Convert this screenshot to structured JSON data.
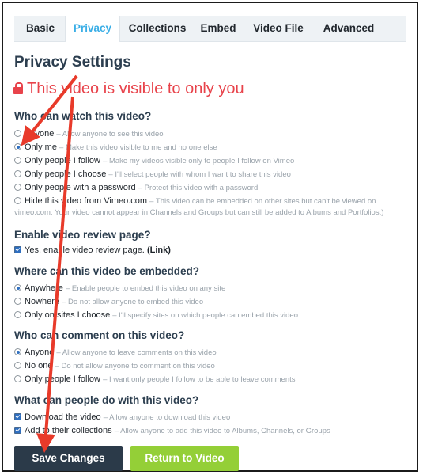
{
  "tabs": [
    {
      "label": "Basic",
      "active": false
    },
    {
      "label": "Privacy",
      "active": true
    },
    {
      "label": "Collections",
      "active": false
    },
    {
      "label": "Embed",
      "active": false
    },
    {
      "label": "Video File",
      "active": false
    },
    {
      "label": "Advanced",
      "active": false
    }
  ],
  "page_title": "Privacy Settings",
  "visibility_note": "This video is visible to only you",
  "who_watch": {
    "heading": "Who can watch this video?",
    "options": [
      {
        "label": "Anyone",
        "desc": "– Allow anyone to see this video",
        "selected": false
      },
      {
        "label": "Only me",
        "desc": "– Make this video visible to me and no one else",
        "selected": true
      },
      {
        "label": "Only people I follow",
        "desc": "– Make my videos visible only to people I follow on Vimeo",
        "selected": false
      },
      {
        "label": "Only people I choose",
        "desc": "– I'll select people with whom I want to share this video",
        "selected": false
      },
      {
        "label": "Only people with a password",
        "desc": "– Protect this video with a password",
        "selected": false
      },
      {
        "label": "Hide this video from Vimeo.com",
        "desc": "– This video can be embedded on other sites but can't be viewed on",
        "selected": false
      }
    ],
    "hide_desc_line2": "vimeo.com. Your video cannot appear in Channels and Groups but can still be added to Albums and Portfolios.)"
  },
  "review": {
    "heading": "Enable video review page?",
    "label": "Yes, enable video review page.",
    "link": "(Link)",
    "checked": true
  },
  "embed": {
    "heading": "Where can this video be embedded?",
    "options": [
      {
        "label": "Anywhere",
        "desc": "– Enable people to embed this video on any site",
        "selected": true
      },
      {
        "label": "Nowhere",
        "desc": "– Do not allow anyone to embed this video",
        "selected": false
      },
      {
        "label": "Only on sites I choose",
        "desc": "– I'll specify sites on which people can embed this video",
        "selected": false
      }
    ]
  },
  "comment": {
    "heading": "Who can comment on this video?",
    "options": [
      {
        "label": "Anyone",
        "desc": "– Allow anyone to leave comments on this video",
        "selected": true
      },
      {
        "label": "No one",
        "desc": "– Do not allow anyone to comment on this video",
        "selected": false
      },
      {
        "label": "Only people I follow",
        "desc": "– I want only people I follow to be able to leave comments",
        "selected": false
      }
    ]
  },
  "can_do": {
    "heading": "What can people do with this video?",
    "options": [
      {
        "label": "Download the video",
        "desc": "– Allow anyone to download this video",
        "checked": true
      },
      {
        "label": "Add to their collections",
        "desc": "– Allow anyone to add this video to Albums, Channels, or Groups",
        "checked": true
      }
    ]
  },
  "buttons": {
    "save": "Save Changes",
    "return": "Return to Video"
  },
  "colors": {
    "accent": "#3aaee6",
    "warning": "#e8434b",
    "save_bg": "#2b3a49",
    "return_bg": "#94cf37",
    "annotation": "#e83a2a"
  }
}
